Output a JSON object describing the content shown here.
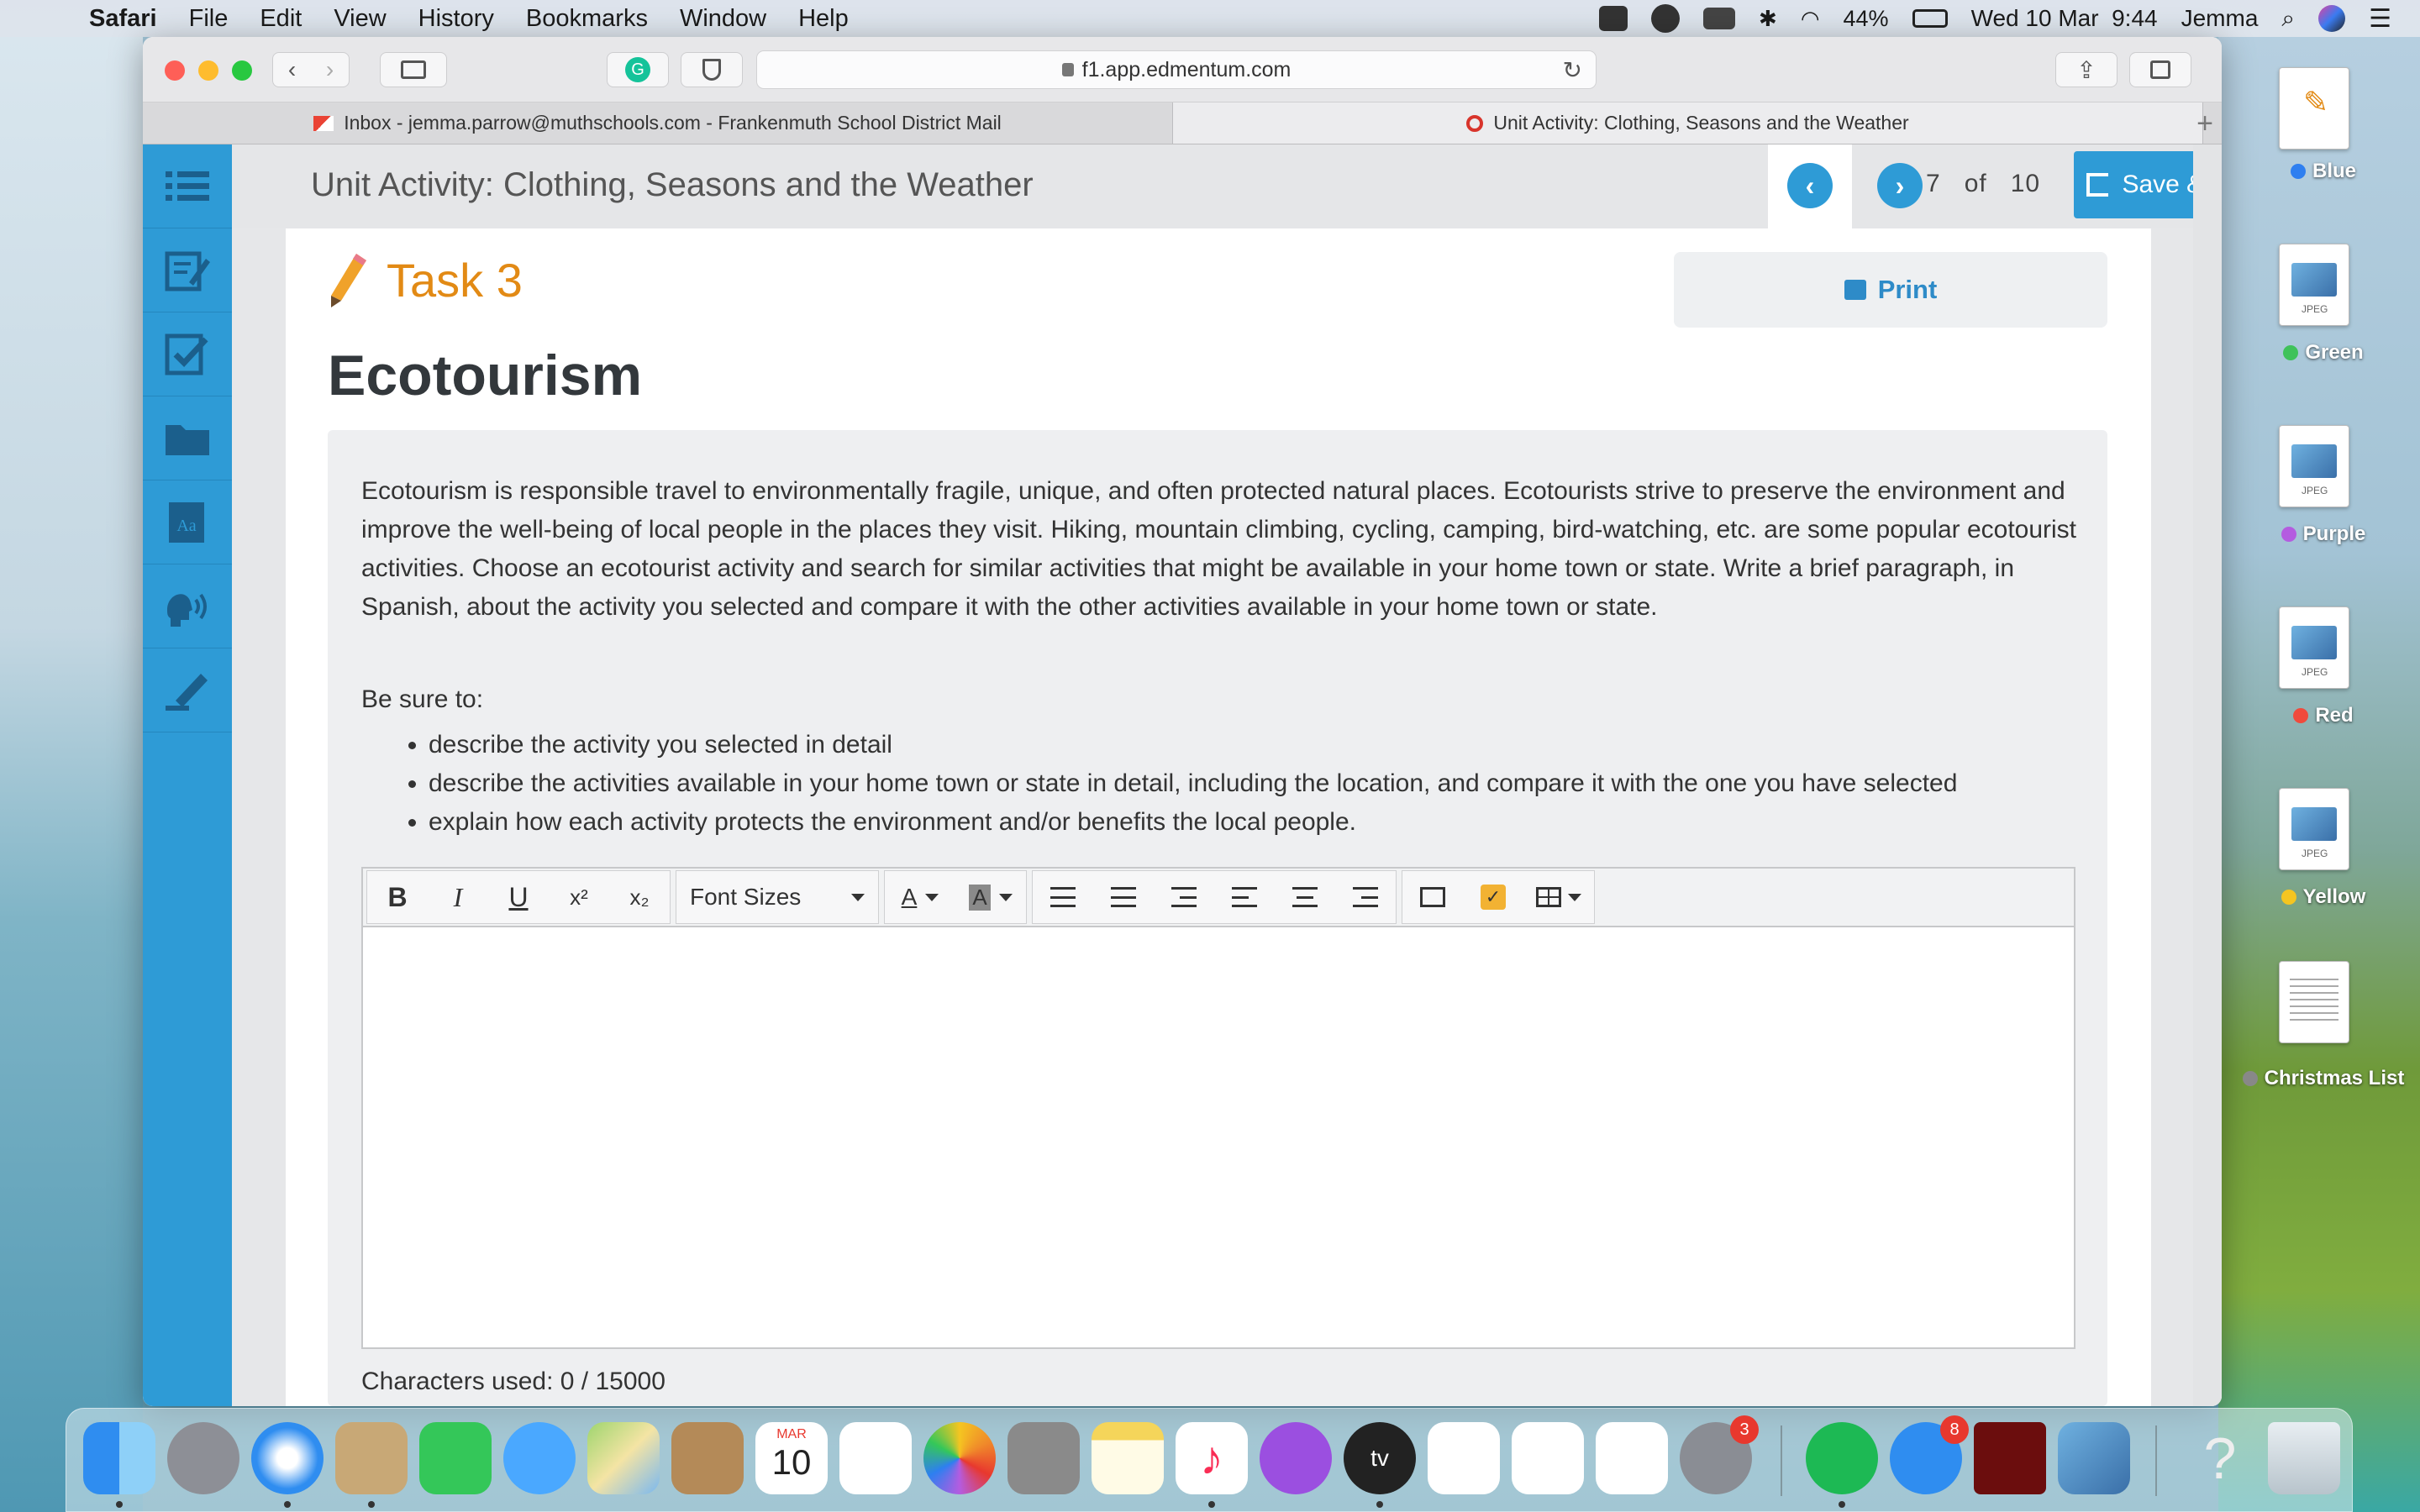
{
  "menubar": {
    "app": "Safari",
    "items": [
      "File",
      "Edit",
      "View",
      "History",
      "Bookmarks",
      "Window",
      "Help"
    ],
    "battery": "44%",
    "datetime": "Wed 10 Mar  9:44",
    "user": "Jemma"
  },
  "browser": {
    "url": "f1.app.edmentum.com",
    "tabs": [
      {
        "title": "Inbox - jemma.parrow@muthschools.com - Frankenmuth School District Mail"
      },
      {
        "title": "Unit Activity: Clothing, Seasons and the Weather"
      }
    ]
  },
  "app": {
    "header_title": "Unit Activity: Clothing, Seasons and the Weather",
    "page_current": "7",
    "page_of": "of",
    "page_total": "10",
    "save_label": "Save & Exit",
    "task_label": "Task 3",
    "print_label": "Print",
    "heading": "Ecotourism",
    "paragraph": "Ecotourism is responsible travel to environmentally fragile, unique, and often protected natural places. Ecotourists strive to preserve the environment and improve the well-being of local people in the places they visit.  Hiking, mountain climbing, cycling, camping, bird-watching, etc. are some popular ecotourist activities. Choose an ecotourist activity and search for similar activities that might be available in your home town or state. Write a brief paragraph, in Spanish, about the activity you selected and compare it with the other activities available in your home town or state.",
    "be_sure": "Be sure to:",
    "bullets": [
      "describe the activity you selected in detail",
      "describe the activities available in your home town or state in detail, including the location, and compare it with the one you have selected",
      "explain how each activity protects the environment and/or benefits the local people."
    ],
    "editor": {
      "bold": "B",
      "italic": "I",
      "underline": "U",
      "superscript": "x²",
      "subscript": "x₂",
      "font_sizes": "Font Sizes",
      "font_color": "A",
      "bg_color": "A",
      "value": ""
    },
    "chars_used": "Characters used: 0 / 15000"
  },
  "desktop": {
    "items": [
      {
        "label": "Blue",
        "color": "#2e7ff0"
      },
      {
        "label": "Green",
        "color": "#3fc25a"
      },
      {
        "label": "Purple",
        "color": "#b45ce0"
      },
      {
        "label": "Red",
        "color": "#f04a3c"
      },
      {
        "label": "Yellow",
        "color": "#f5c521"
      },
      {
        "label": "Christmas List",
        "color": "#888888"
      }
    ]
  },
  "dock": {
    "badges": {
      "system_prefs": "3",
      "app_store": "8"
    },
    "calendar_month": "MAR",
    "calendar_day": "10"
  },
  "colors": {
    "accent": "#2e9bd6",
    "task_orange": "#e28a15"
  }
}
